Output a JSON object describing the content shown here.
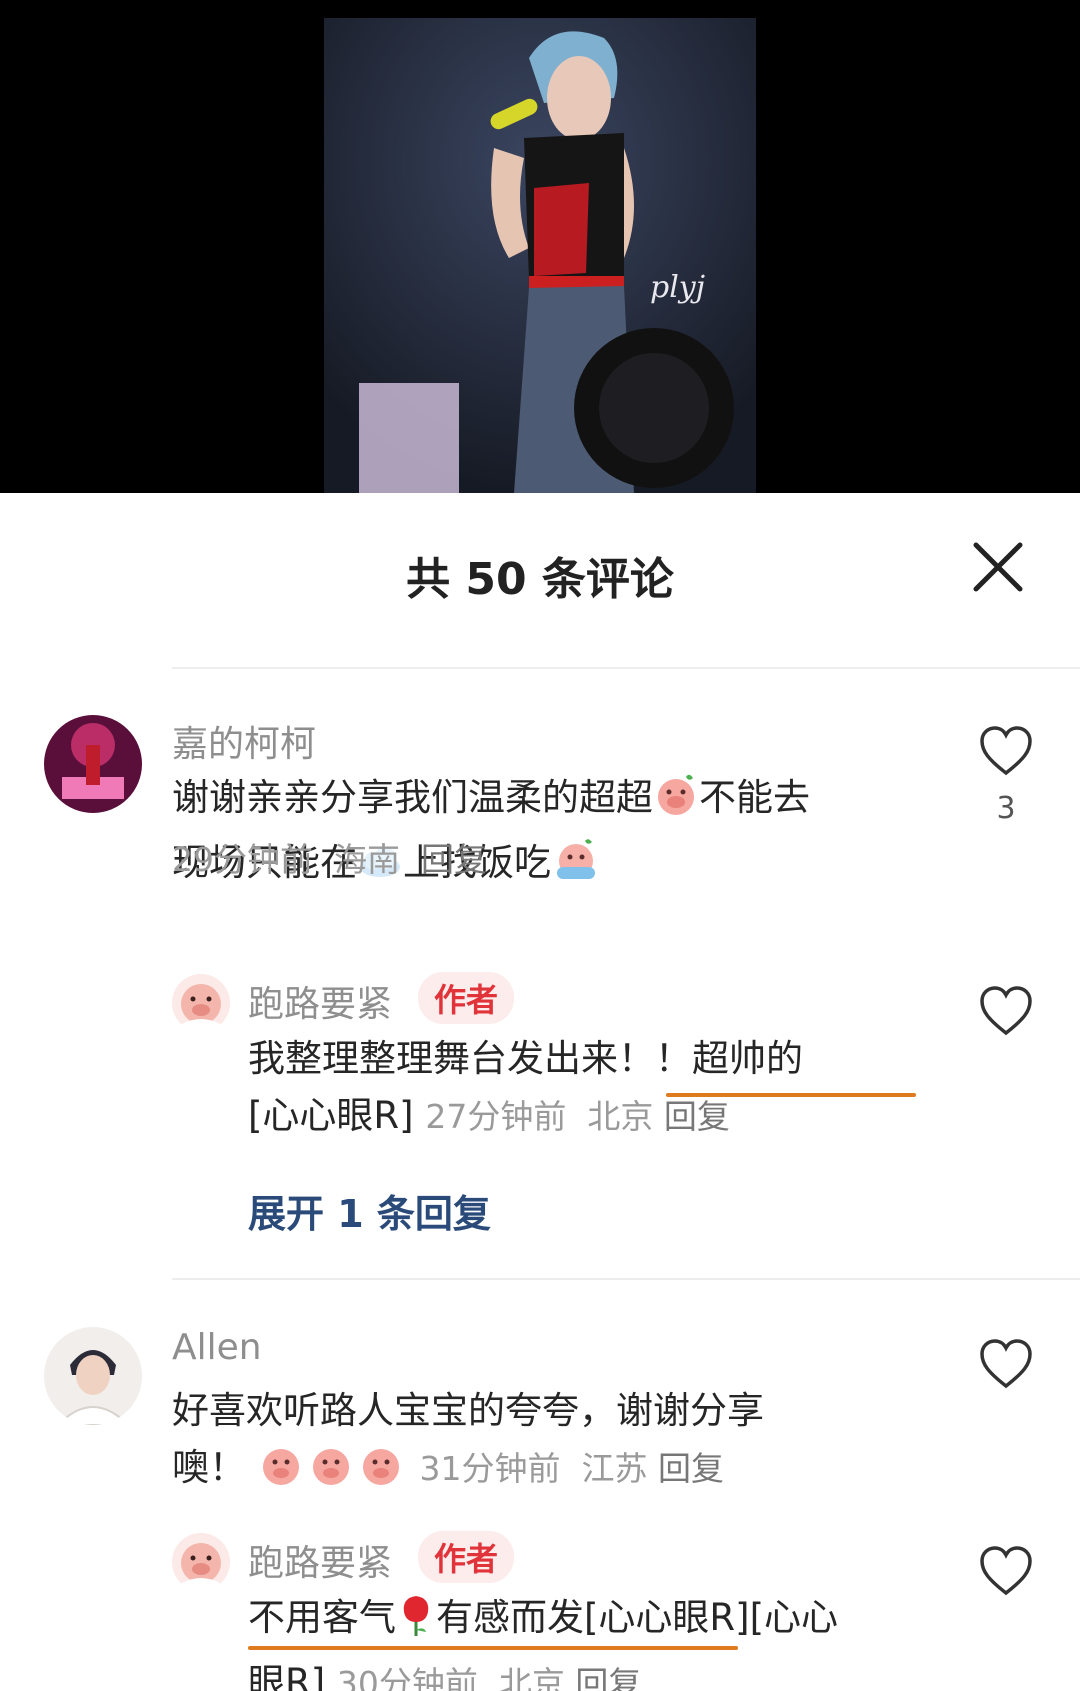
{
  "video": {
    "watermark": "plyj"
  },
  "sheet": {
    "title": "共 50 条评论"
  },
  "comments": [
    {
      "username": "嘉的柯柯",
      "text_line1_a": "谢谢亲亲分享我们温柔的超超",
      "text_line1_b": "不能去",
      "text_line2_a": "现场只能在",
      "text_line2_b": "上找饭吃",
      "time": "29分钟前",
      "location": "海南",
      "reply_label": "回复",
      "likes": "3",
      "replies": [
        {
          "username": "跑路要紧",
          "badge": "作者",
          "text_line1": "我整理整理舞台发出来！！超帅的",
          "text_line2": "[心心眼R]",
          "time": "27分钟前",
          "location": "北京",
          "reply_label": "回复"
        }
      ],
      "expand_label": "展开 1 条回复"
    },
    {
      "username": "Allen",
      "text_line1": "好喜欢听路人宝宝的夸夸，谢谢分享",
      "text_line2": "噢！",
      "time": "31分钟前",
      "location": "江苏",
      "reply_label": "回复",
      "replies": [
        {
          "username": "跑路要紧",
          "badge": "作者",
          "text_line1_a": "不用客气",
          "text_line1_b": "有感而发[心心眼R][心心",
          "text_line2": "眼R]",
          "time": "30分钟前",
          "location": "北京",
          "reply_label": "回复"
        }
      ]
    }
  ],
  "colors": {
    "author_badge_bg": "#fdecec",
    "author_badge_text": "#e0343a",
    "underline": "#e07a1f",
    "expand_link": "#2a4a7a"
  }
}
